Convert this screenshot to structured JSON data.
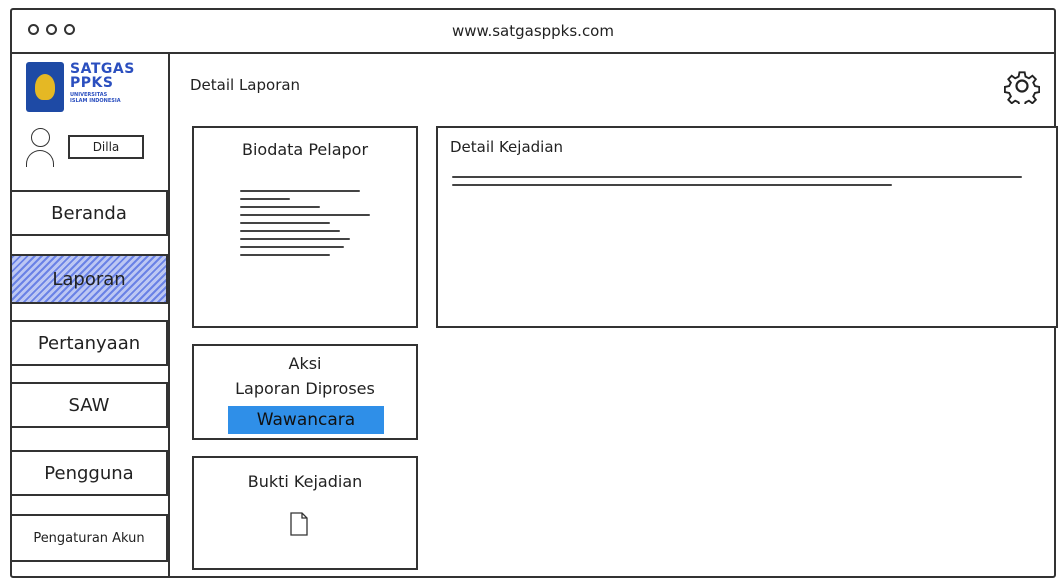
{
  "browser": {
    "url": "www.satgasppks.com"
  },
  "logo": {
    "title_line1": "SATGAS",
    "title_line2": "PPKS",
    "sub": "UNIVERSITAS ISLAM INDONESIA"
  },
  "user": {
    "name": "Dilla"
  },
  "sidebar": {
    "items": [
      {
        "label": "Beranda"
      },
      {
        "label": "Laporan"
      },
      {
        "label": "Pertanyaan"
      },
      {
        "label": "SAW"
      },
      {
        "label": "Pengguna"
      },
      {
        "label": "Pengaturan Akun"
      }
    ]
  },
  "main": {
    "title": "Detail Laporan",
    "biodata": {
      "title": "Biodata Pelapor"
    },
    "kejadian": {
      "title": "Detail Kejadian"
    },
    "aksi": {
      "title": "Aksi",
      "status": "Laporan Diproses",
      "button": "Wawancara"
    },
    "bukti": {
      "title": "Bukti Kejadian"
    }
  },
  "colors": {
    "active_nav": "#6a82e6",
    "button": "#2f8fe8",
    "logo": "#2b4fbf"
  },
  "icons": [
    "user-avatar-icon",
    "gear-icon",
    "document-icon"
  ]
}
